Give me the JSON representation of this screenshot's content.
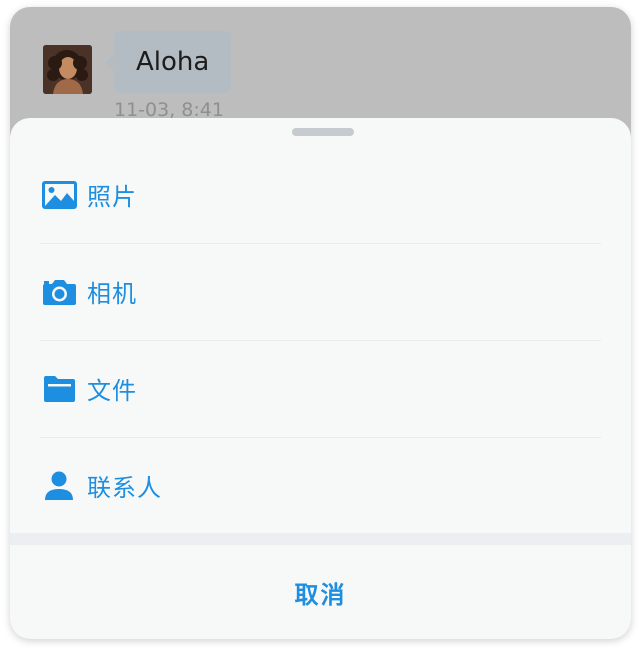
{
  "chat": {
    "message_text": "Aloha",
    "timestamp": "11-03, 8:41"
  },
  "action_sheet": {
    "items": [
      {
        "label": "照片",
        "icon": "photo-icon"
      },
      {
        "label": "相机",
        "icon": "camera-icon"
      },
      {
        "label": "文件",
        "icon": "folder-icon"
      },
      {
        "label": "联系人",
        "icon": "contact-icon"
      }
    ],
    "cancel_label": "取消"
  },
  "colors": {
    "accent": "#1e8fe0",
    "sheet_background": "#f7f8f8",
    "overlay": "#bdbdbd",
    "bubble": "#b3bcc3"
  }
}
